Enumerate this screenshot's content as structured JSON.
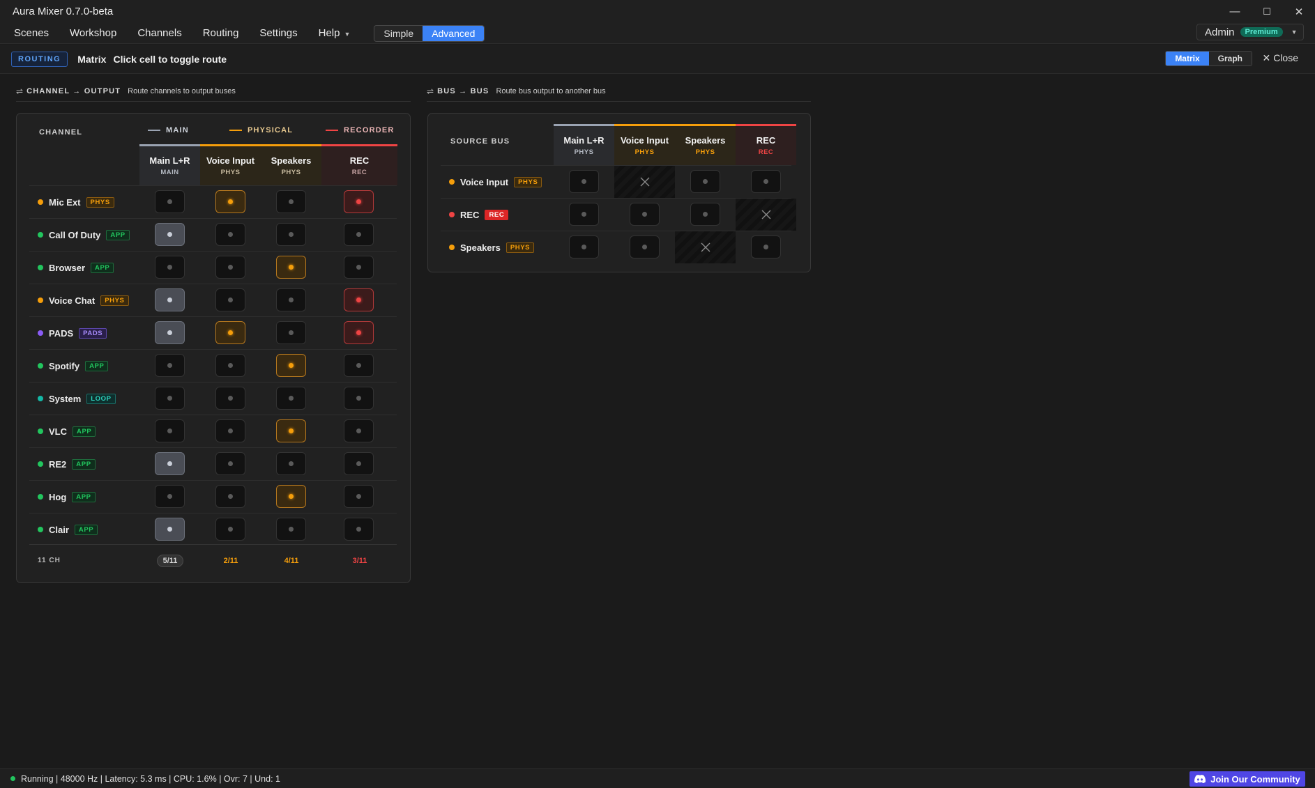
{
  "window": {
    "title": "Aura Mixer 0.7.0-beta",
    "minimize": "—",
    "maximize": "☐",
    "close": "✕"
  },
  "menu": {
    "items": [
      "Scenes",
      "Workshop",
      "Channels",
      "Routing",
      "Settings"
    ],
    "help_label": "Help",
    "mode_simple": "Simple",
    "mode_advanced": "Advanced",
    "active_mode": "Advanced"
  },
  "user": {
    "name": "Admin",
    "tier": "Premium"
  },
  "routing": {
    "tag": "ROUTING",
    "title": "Matrix",
    "hint": "Click cell to toggle route",
    "view_matrix": "Matrix",
    "view_graph": "Graph",
    "active_view": "Matrix",
    "close_label": "Close"
  },
  "channel_matrix": {
    "section_label": "CHANNEL → OUTPUT",
    "section_desc": "Route channels to output buses",
    "channel_header": "CHANNEL",
    "groups": [
      {
        "label": "MAIN",
        "color": "#9aa3b2"
      },
      {
        "label": "PHYSICAL",
        "color": "#f59e0b"
      },
      {
        "label": "RECORDER",
        "color": "#ef4444"
      }
    ],
    "columns": [
      {
        "name": "Main L+R",
        "type": "MAIN",
        "kind": "main"
      },
      {
        "name": "Voice Input",
        "type": "PHYS",
        "kind": "phys"
      },
      {
        "name": "Speakers",
        "type": "PHYS",
        "kind": "phys"
      },
      {
        "name": "REC",
        "type": "REC",
        "kind": "rec"
      }
    ],
    "rows": [
      {
        "name": "Mic Ext",
        "badge": "PHYS",
        "dot": "#f59e0b",
        "routes": [
          false,
          true,
          false,
          true
        ]
      },
      {
        "name": "Call Of Duty",
        "badge": "APP",
        "dot": "#22c55e",
        "routes": [
          true,
          false,
          false,
          false
        ]
      },
      {
        "name": "Browser",
        "badge": "APP",
        "dot": "#22c55e",
        "routes": [
          false,
          false,
          true,
          false
        ]
      },
      {
        "name": "Voice Chat",
        "badge": "PHYS",
        "dot": "#f59e0b",
        "routes": [
          true,
          false,
          false,
          true
        ]
      },
      {
        "name": "PADS",
        "badge": "PADS",
        "dot": "#8b5cf6",
        "routes": [
          true,
          true,
          false,
          true
        ]
      },
      {
        "name": "Spotify",
        "badge": "APP",
        "dot": "#22c55e",
        "routes": [
          false,
          false,
          true,
          false
        ]
      },
      {
        "name": "System",
        "badge": "LOOP",
        "dot": "#14b8a6",
        "routes": [
          false,
          false,
          false,
          false
        ]
      },
      {
        "name": "VLC",
        "badge": "APP",
        "dot": "#22c55e",
        "routes": [
          false,
          false,
          true,
          false
        ]
      },
      {
        "name": "RE2",
        "badge": "APP",
        "dot": "#22c55e",
        "routes": [
          true,
          false,
          false,
          false
        ]
      },
      {
        "name": "Hog",
        "badge": "APP",
        "dot": "#22c55e",
        "routes": [
          false,
          false,
          true,
          false
        ]
      },
      {
        "name": "Clair",
        "badge": "APP",
        "dot": "#22c55e",
        "routes": [
          true,
          false,
          false,
          false
        ]
      }
    ],
    "footer": {
      "channel_count": "11 CH",
      "counts": [
        "5/11",
        "2/11",
        "4/11",
        "3/11"
      ]
    }
  },
  "bus_matrix": {
    "section_label": "BUS → BUS",
    "section_desc": "Route bus output to another bus",
    "source_header": "SOURCE BUS",
    "columns": [
      {
        "name": "Main L+R",
        "type": "PHYS",
        "kind": "main"
      },
      {
        "name": "Voice Input",
        "type": "PHYS",
        "kind": "phys"
      },
      {
        "name": "Speakers",
        "type": "PHYS",
        "kind": "phys"
      },
      {
        "name": "REC",
        "type": "REC",
        "kind": "rec"
      }
    ],
    "rows": [
      {
        "name": "Voice Input",
        "badge": "PHYS",
        "dot": "#f59e0b",
        "self_col": 1
      },
      {
        "name": "REC",
        "badge": "REC",
        "dot": "#ef4444",
        "self_col": 3
      },
      {
        "name": "Speakers",
        "badge": "PHYS",
        "dot": "#f59e0b",
        "self_col": 2
      }
    ]
  },
  "status": {
    "text": "Running | 48000 Hz | Latency: 5.3 ms | CPU: 1.6% | Ovr: 7 | Und: 1",
    "community_label": "Join Our Community"
  },
  "colors": {
    "accent": "#3b82f6",
    "main": "#9aa3b2",
    "phys": "#f59e0b",
    "rec": "#ef4444",
    "running": "#22c55e",
    "community": "#4f46e5"
  }
}
